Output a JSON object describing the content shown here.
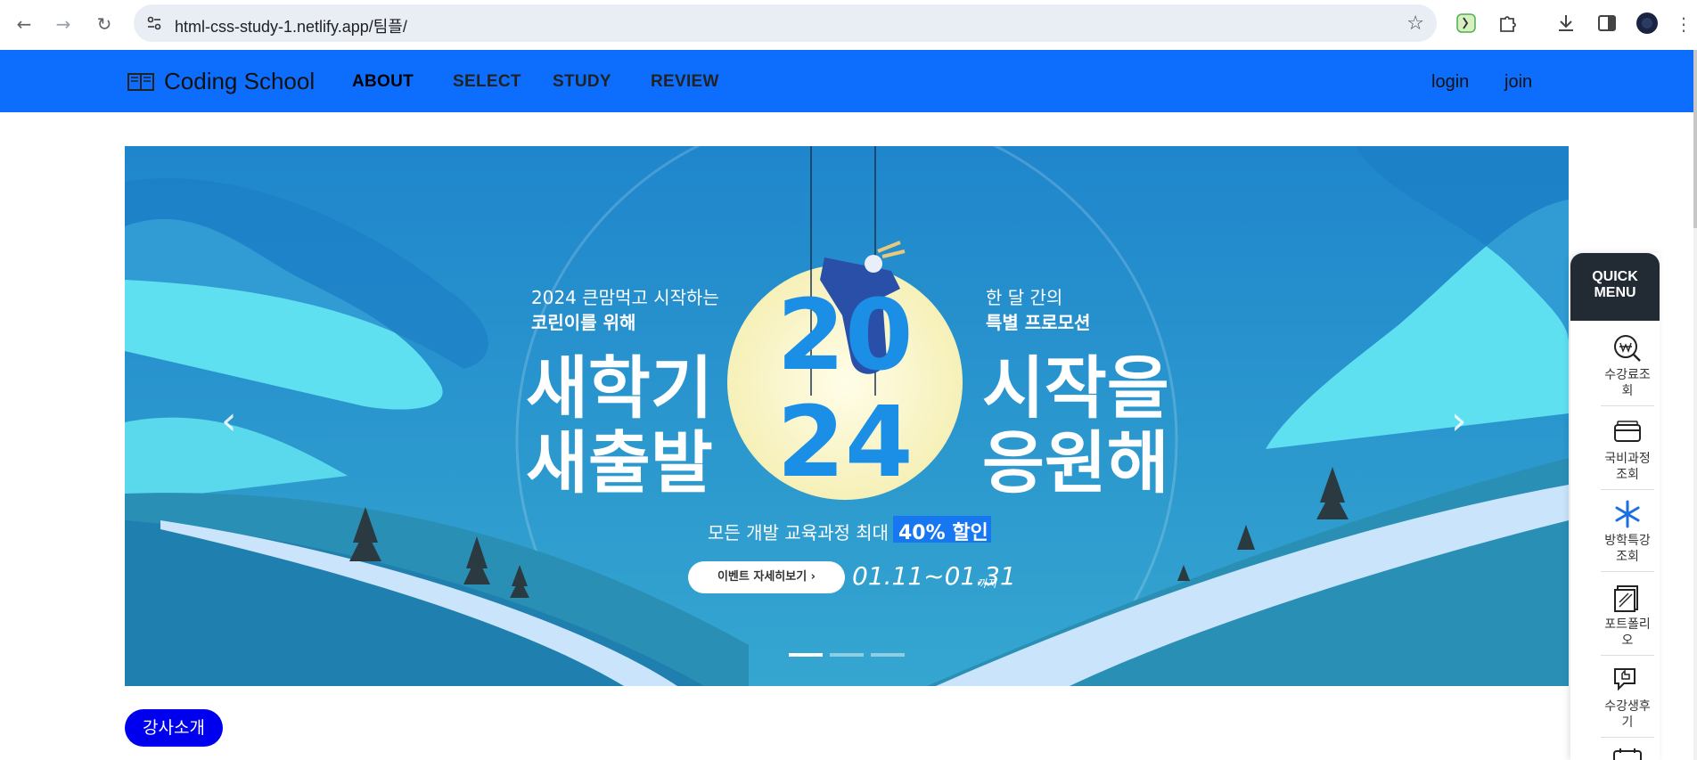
{
  "browser": {
    "url": "html-css-study-1.netlify.app/팀플/"
  },
  "site": {
    "brand": "Coding School",
    "nav": [
      "ABOUT",
      "SELECT",
      "STUDY",
      "REVIEW"
    ],
    "login": "login",
    "join": "join"
  },
  "banner": {
    "left_top": "2024 큰맘먹고 시작하는",
    "left_sub": "코린이를 위해",
    "left_big_1": "새학기",
    "left_big_2": "새출발",
    "right_top": "한 달 간의",
    "right_sub": "특별 프로모션",
    "right_big_1": "시작을",
    "right_big_2": "응원해",
    "year_top": "20",
    "year_bottom": "24",
    "discount_text": "모든 개발 교육과정 최대",
    "discount_badge": "40% 할인",
    "event_button": "이벤트 자세히보기 ›",
    "period": "01.11~01.31",
    "period_suffix": "까지",
    "prev_arrow": "‹",
    "next_arrow": "›",
    "slides_total": 3,
    "slide_active": 1
  },
  "quick_menu": {
    "title_1": "QUICK",
    "title_2": "MENU",
    "items": [
      {
        "label": "수강료조회",
        "icon": "search-won-icon"
      },
      {
        "label": "국비과정조회",
        "icon": "credit-card-icon"
      },
      {
        "label": "방학특강조회",
        "icon": "snowflake-icon"
      },
      {
        "label": "포트폴리오",
        "icon": "portfolio-icon"
      },
      {
        "label": "수강생후기",
        "icon": "review-chat-icon"
      }
    ]
  },
  "section": {
    "instructor_button": "강사소개"
  },
  "colors": {
    "header_blue": "#0d6efd",
    "pill_blue": "#0000ee",
    "quick_dark": "#222b33"
  }
}
